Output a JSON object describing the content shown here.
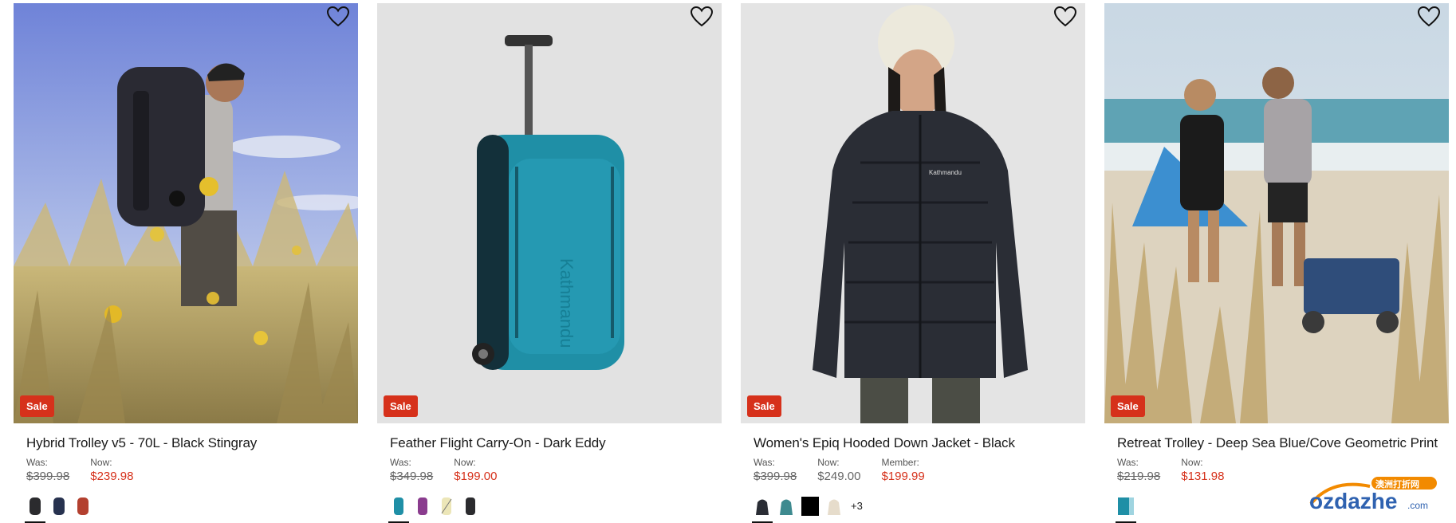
{
  "products": [
    {
      "title": "Hybrid Trolley v5 - 70L - Black Stingray",
      "badge": "Sale",
      "was_label": "Was:",
      "was_price": "$399.98",
      "now_label": "Now:",
      "now_price": "$239.98",
      "swatches": [
        "black-bag",
        "navy-bag",
        "red-bag"
      ]
    },
    {
      "title": "Feather Flight Carry-On - Dark Eddy",
      "badge": "Sale",
      "was_label": "Was:",
      "was_price": "$349.98",
      "now_label": "Now:",
      "now_price": "$199.00",
      "swatches": [
        "teal-case",
        "purple-case",
        "cream-case",
        "black-case"
      ]
    },
    {
      "title": "Women's Epiq Hooded Down Jacket - Black",
      "badge": "Sale",
      "was_label": "Was:",
      "was_price": "$399.98",
      "now_label": "Now:",
      "now_price": "$249.00",
      "member_label": "Member:",
      "member_price": "$199.99",
      "swatches": [
        "black-jacket",
        "teal-jacket",
        "black-square",
        "cream-jacket"
      ],
      "more_colors": "+3"
    },
    {
      "title": "Retreat Trolley - Deep Sea Blue/Cove Geometric Print",
      "badge": "Sale",
      "was_label": "Was:",
      "was_price": "$219.98",
      "now_label": "Now:",
      "now_price": "$131.98",
      "swatches": [
        "blue-trolley"
      ]
    }
  ],
  "watermark": {
    "brand": "ozdazhe",
    "domain": ".com",
    "chinese": "澳洲打折网"
  },
  "colors": {
    "sale_red": "#d6311b",
    "teal": "#1f8fa6"
  }
}
